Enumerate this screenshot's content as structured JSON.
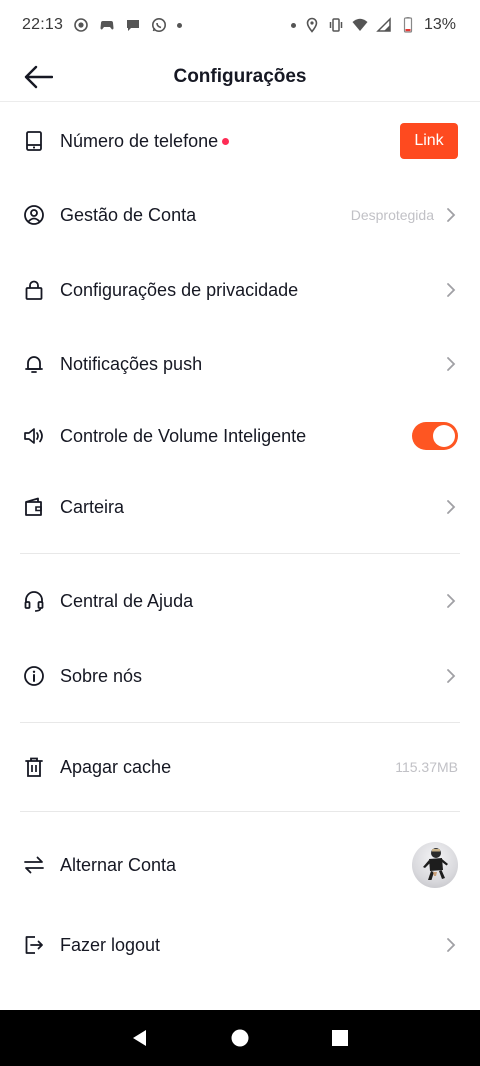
{
  "status_bar": {
    "time": "22:13",
    "battery_pct": "13%"
  },
  "header": {
    "title": "Configurações"
  },
  "rows": {
    "phone": {
      "label": "Número de telefone",
      "action": "Link"
    },
    "account": {
      "label": "Gestão de Conta",
      "value": "Desprotegida"
    },
    "privacy": {
      "label": "Configurações de privacidade"
    },
    "push": {
      "label": "Notificações push"
    },
    "volume": {
      "label": "Controle de Volume Inteligente",
      "toggle_on": true
    },
    "wallet": {
      "label": "Carteira"
    },
    "help": {
      "label": "Central de Ajuda"
    },
    "about": {
      "label": "Sobre nós"
    },
    "cache": {
      "label": "Apagar cache",
      "value": "115.37MB"
    },
    "switch": {
      "label": "Alternar Conta"
    },
    "logout": {
      "label": "Fazer logout"
    }
  },
  "colors": {
    "accent": "#fe4a1f",
    "notification_dot": "#fe2c55",
    "muted_text": "#c1c1c6"
  }
}
